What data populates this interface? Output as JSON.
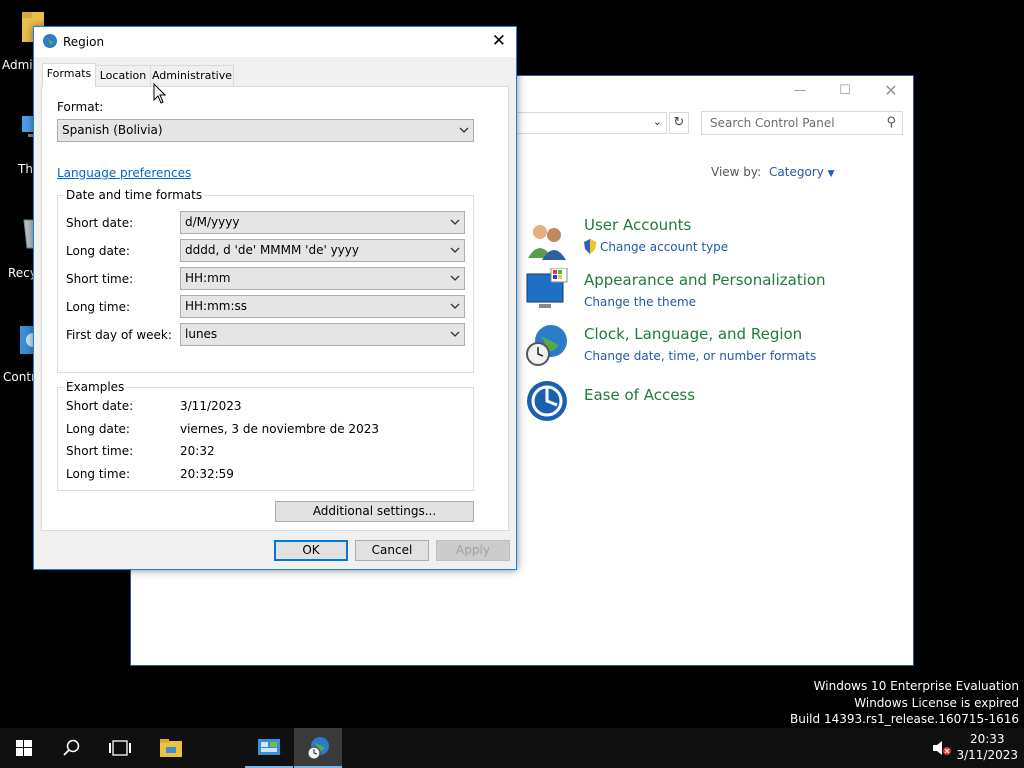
{
  "desktop": {
    "icons": [
      {
        "label": "Admi"
      },
      {
        "label": "Th"
      },
      {
        "label": "Recy"
      },
      {
        "label": "Contr"
      }
    ],
    "watermark": [
      "Windows 10 Enterprise Evaluation",
      "Windows License is expired",
      "Build 14393.rs1_release.160715-1616"
    ]
  },
  "control_panel": {
    "search_placeholder": "Search Control Panel",
    "view_by_label": "View by:",
    "view_by_value": "Category",
    "categories": [
      {
        "title": "User Accounts",
        "link": "Change account type"
      },
      {
        "title": "Appearance and Personalization",
        "link": "Change the theme"
      },
      {
        "title": "Clock, Language, and Region",
        "link": "Change date, time, or number formats"
      },
      {
        "title": "Ease of Access",
        "link": ""
      }
    ]
  },
  "dialog": {
    "title": "Region",
    "tabs": [
      "Formats",
      "Location",
      "Administrative"
    ],
    "format_label": "Format:",
    "format_value": "Spanish (Bolivia)",
    "language_link": "Language preferences",
    "dt_group": "Date and time formats",
    "fields": [
      {
        "label": "Short date:",
        "value": "d/M/yyyy"
      },
      {
        "label": "Long date:",
        "value": "dddd, d 'de' MMMM 'de' yyyy"
      },
      {
        "label": "Short time:",
        "value": "HH:mm"
      },
      {
        "label": "Long time:",
        "value": "HH:mm:ss"
      },
      {
        "label": "First day of week:",
        "value": "lunes"
      }
    ],
    "examples_group": "Examples",
    "examples": [
      {
        "label": "Short date:",
        "value": "3/11/2023"
      },
      {
        "label": "Long date:",
        "value": "viernes, 3 de noviembre de 2023"
      },
      {
        "label": "Short time:",
        "value": "20:32"
      },
      {
        "label": "Long time:",
        "value": "20:32:59"
      }
    ],
    "additional_settings": "Additional settings...",
    "ok": "OK",
    "cancel": "Cancel",
    "apply": "Apply"
  },
  "taskbar": {
    "time": "20:33",
    "date": "3/11/2023"
  },
  "colors": {
    "accent": "#0078d7",
    "cp_category_title": "#1e7b3c",
    "cp_link": "#1e5aa8"
  }
}
